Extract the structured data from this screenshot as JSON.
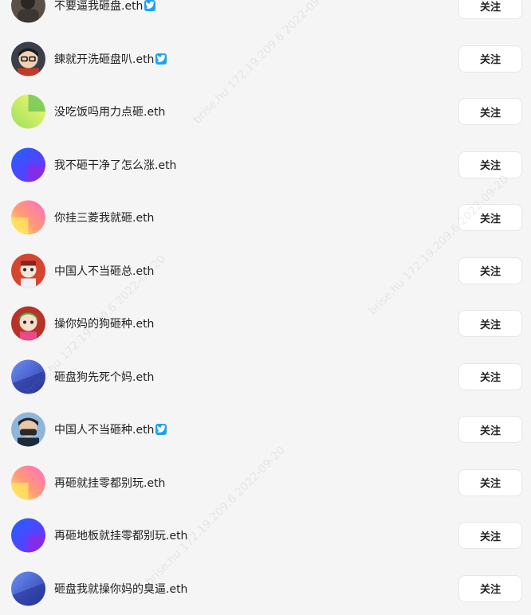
{
  "users": [
    {
      "name": "不要逼我砸盘.eth",
      "verified": true,
      "avatar": "dark-photo",
      "follow_label": "关注"
    },
    {
      "name": "鍊就开洗砸盘叭.eth",
      "verified": true,
      "avatar": "cartoon-boy",
      "follow_label": "关注"
    },
    {
      "name": "没吃饭吗用力点砸.eth",
      "verified": false,
      "avatar": "gradient-green-yellow",
      "follow_label": "关注"
    },
    {
      "name": "我不砸干净了怎么涨.eth",
      "verified": false,
      "avatar": "gradient-blue-purple",
      "follow_label": "关注"
    },
    {
      "name": "你挂三菱我就砸.eth",
      "verified": false,
      "avatar": "gradient-pink-yellow",
      "follow_label": "关注"
    },
    {
      "name": "中国人不当砸总.eth",
      "verified": false,
      "avatar": "red-character",
      "follow_label": "关注"
    },
    {
      "name": "操你妈的狗砸种.eth",
      "verified": false,
      "avatar": "green-hair-character",
      "follow_label": "关注"
    },
    {
      "name": "砸盘狗先死个妈.eth",
      "verified": false,
      "avatar": "gradient-blue-navy",
      "follow_label": "关注"
    },
    {
      "name": "中国人不当砸种.eth",
      "verified": true,
      "avatar": "masked-character",
      "follow_label": "关注"
    },
    {
      "name": "再砸就挂零都别玩.eth",
      "verified": false,
      "avatar": "gradient-pink-yellow",
      "follow_label": "关注"
    },
    {
      "name": "再砸地板就挂零都别玩.eth",
      "verified": false,
      "avatar": "gradient-blue-purple",
      "follow_label": "关注"
    },
    {
      "name": "砸盘我就操你妈的臭逼.eth",
      "verified": false,
      "avatar": "gradient-blue-navy",
      "follow_label": "关注"
    }
  ],
  "watermark": "brise.hu 172.19.209.6 2022-09-20",
  "colors": {
    "verified_badge": "#1da1f2",
    "button_bg": "#ffffff",
    "page_bg": "#f5f5f5"
  }
}
